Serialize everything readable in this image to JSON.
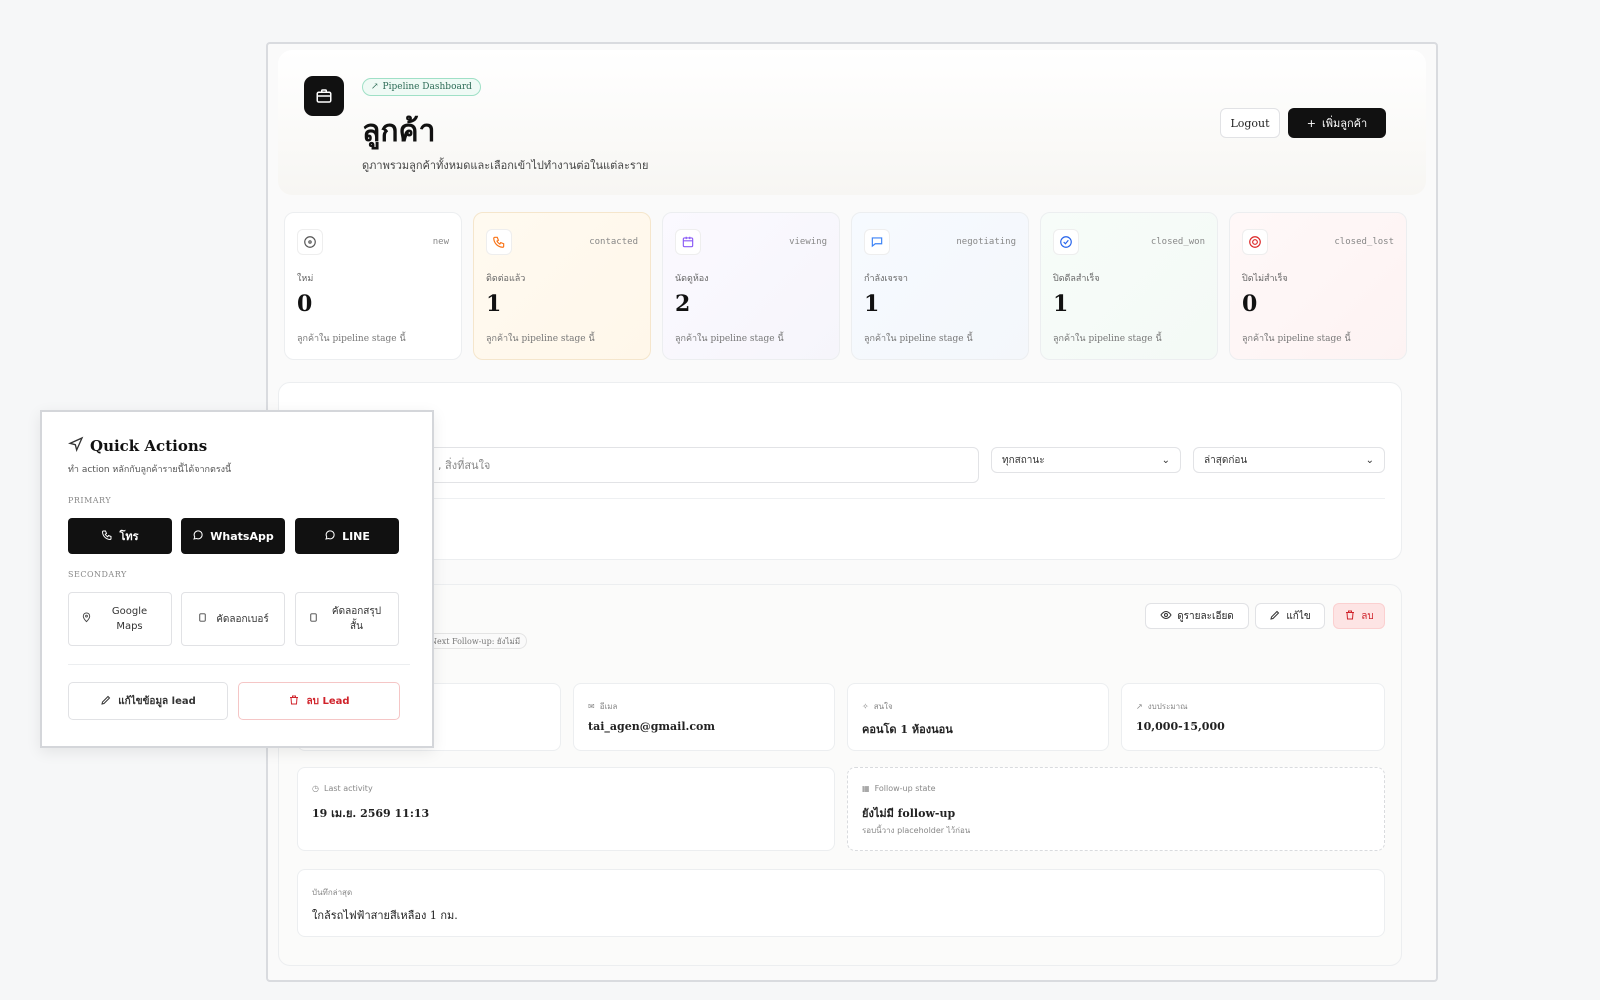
{
  "header": {
    "pill": "Pipeline Dashboard",
    "title": "ลูกค้า",
    "subtitle": "ดูภาพรวมลูกค้าทั้งหมดและเลือกเข้าไปทำงานต่อในแต่ละราย",
    "logout_label": "Logout",
    "add_label": "เพิ่มลูกค้า"
  },
  "stages": [
    {
      "key": "new",
      "label": "ใหม่",
      "count": "0",
      "desc": "ลูกค้าใน pipeline stage นี้",
      "color": "#6b7280",
      "icon": "circle-icon"
    },
    {
      "key": "contacted",
      "label": "ติดต่อแล้ว",
      "count": "1",
      "desc": "ลูกค้าใน pipeline stage นี้",
      "color": "#f97316",
      "icon": "phone-icon"
    },
    {
      "key": "viewing",
      "label": "นัดดูห้อง",
      "count": "2",
      "desc": "ลูกค้าใน pipeline stage นี้",
      "color": "#8b5cf6",
      "icon": "calendar-icon"
    },
    {
      "key": "negotiating",
      "label": "กำลังเจรจา",
      "count": "1",
      "desc": "ลูกค้าใน pipeline stage นี้",
      "color": "#3b82f6",
      "icon": "chat-icon"
    },
    {
      "key": "closed_won",
      "label": "ปิดดีลสำเร็จ",
      "count": "1",
      "desc": "ลูกค้าใน pipeline stage นี้",
      "color": "#2563eb",
      "icon": "check-circle-icon"
    },
    {
      "key": "closed_lost",
      "label": "ปิดไม่สำเร็จ",
      "count": "0",
      "desc": "ลูกค้าใน pipeline stage นี้",
      "color": "#dc2626",
      "icon": "target-icon"
    }
  ],
  "filters": {
    "search_placeholder_tail": ", สิ่งที่สนใจ",
    "status_selected": "ทุกสถานะ",
    "sort_selected": "ล่าสุดก่อน"
  },
  "lead": {
    "tag": "Next Follow-up: ยังไม่มี",
    "view_label": "ดูรายละเอียด",
    "edit_label": "แก้ไข",
    "delete_label": "ลบ",
    "email_title": "อีเมล",
    "email_value": "tai_agen@gmail.com",
    "interest_title": "สนใจ",
    "interest_value": "คอนโด 1 ห้องนอน",
    "budget_title": "งบประมาณ",
    "budget_value": "10,000-15,000",
    "activity_title": "Last activity",
    "activity_value": "19 เม.ย. 2569 11:13",
    "followup_title": "Follow-up state",
    "followup_value": "ยังไม่มี follow-up",
    "followup_sub": "รอบนี้วาง placeholder ไว้ก่อน",
    "notes_title": "บันทึกล่าสุด",
    "notes_value": "ใกล้รถไฟฟ้าสายสีเหลือง 1 กม."
  },
  "quick_actions": {
    "title": "Quick Actions",
    "subtitle": "ทำ action หลักกับลูกค้ารายนี้ได้จากตรงนี้",
    "primary_label": "PRIMARY",
    "secondary_label": "SECONDARY",
    "call_label": "โทร",
    "whatsapp_label": "WhatsApp",
    "line_label": "LINE",
    "maps_label": "Google Maps",
    "copy_number_label": "คัดลอกเบอร์",
    "copy_summary_label": "คัดลอกสรุปสั้น",
    "edit_lead_label": "แก้ไขข้อมูล lead",
    "delete_lead_label": "ลบ Lead"
  }
}
